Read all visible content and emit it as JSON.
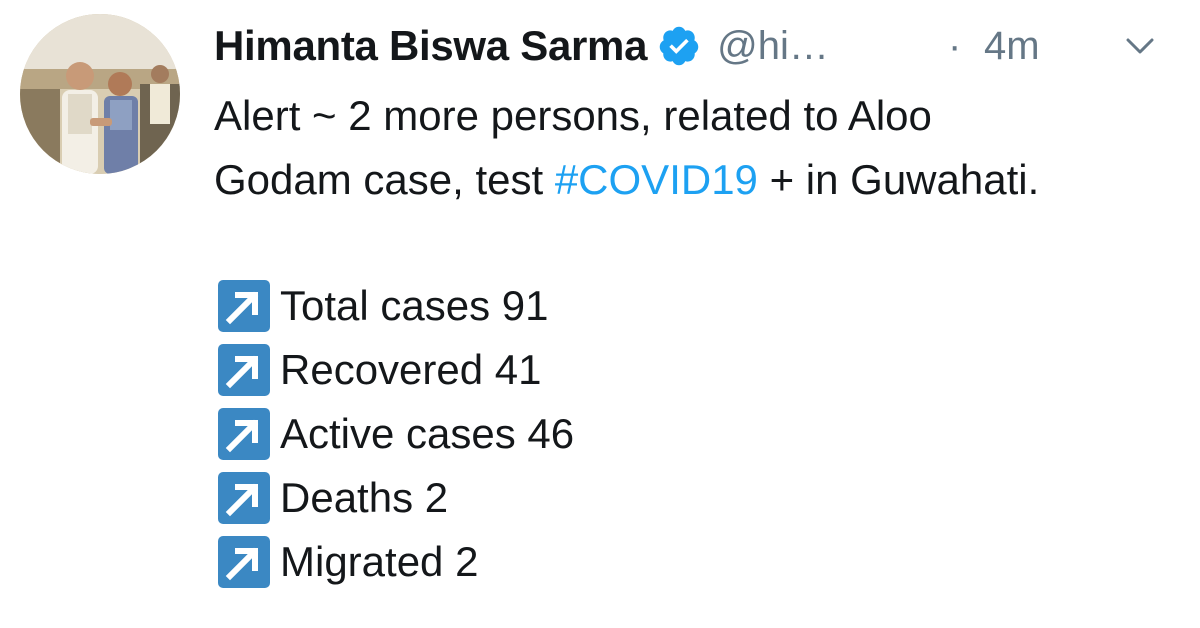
{
  "tweet": {
    "author": {
      "display_name": "Himanta Biswa Sarma",
      "handle": "@hi…",
      "avatar_icon": "profile-photo",
      "verified_icon": "verified-badge-icon"
    },
    "separator": "·",
    "time": "4m",
    "menu_icon": "chevron-down-icon",
    "text": {
      "line1": "Alert ~ 2 more persons, related to Aloo",
      "line2_before": "Godam case, test ",
      "hashtag": "#COVID19",
      "line2_after": " + in Guwahati."
    },
    "stats": [
      {
        "icon": "up-right-arrow-icon",
        "label": "Total cases 91"
      },
      {
        "icon": "up-right-arrow-icon",
        "label": "Recovered 41"
      },
      {
        "icon": "up-right-arrow-icon",
        "label": "Active cases 46"
      },
      {
        "icon": "up-right-arrow-icon",
        "label": "Deaths 2"
      },
      {
        "icon": "up-right-arrow-icon",
        "label": "Migrated 2"
      }
    ]
  },
  "colors": {
    "text": "#14171a",
    "muted": "#657786",
    "link": "#1da1f2",
    "verified": "#1da1f2",
    "arrow_box": "#3b88c3"
  }
}
